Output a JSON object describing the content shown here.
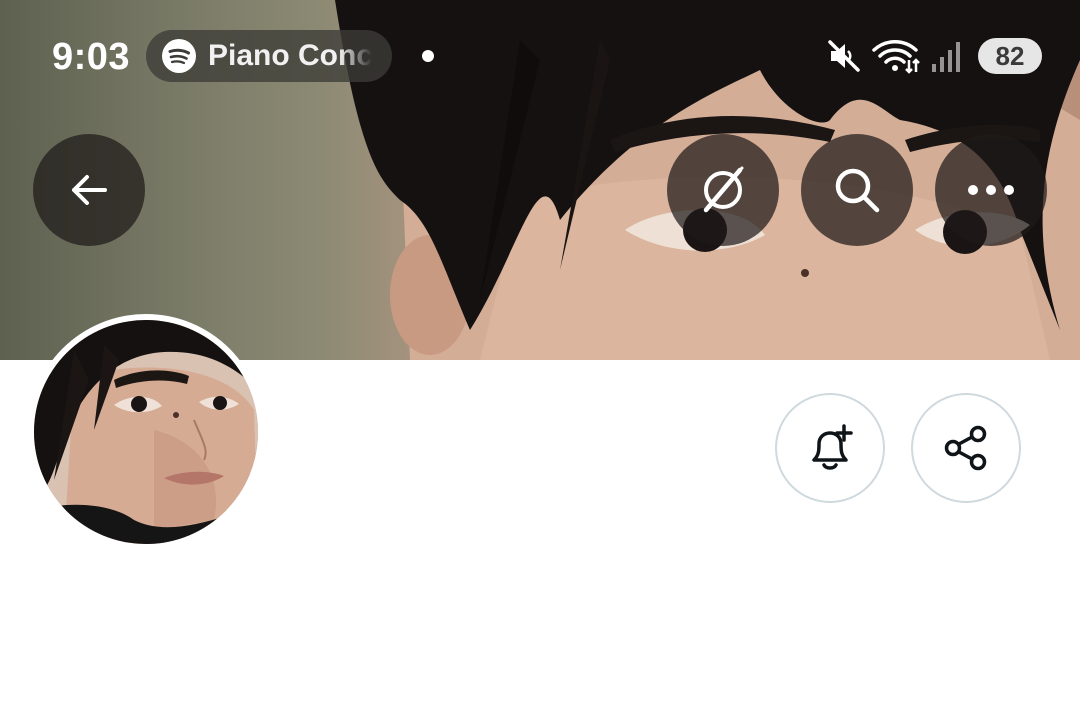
{
  "status_bar": {
    "time": "9:03",
    "now_playing_app": "spotify-icon",
    "now_playing_title": "Piano Concerto",
    "icons": [
      "mute-icon",
      "wifi-icon",
      "signal-icon"
    ],
    "battery": "82"
  },
  "header": {
    "back_icon": "arrow-left-icon",
    "actions": [
      "grok-icon",
      "search-icon",
      "more-icon"
    ]
  },
  "profile": {
    "action_buttons": [
      "bell-plus-icon",
      "share-icon"
    ]
  },
  "colors": {
    "outline_border": "#cfd9de",
    "overlay_button": "#1e1b19",
    "background": "#ffffff"
  }
}
